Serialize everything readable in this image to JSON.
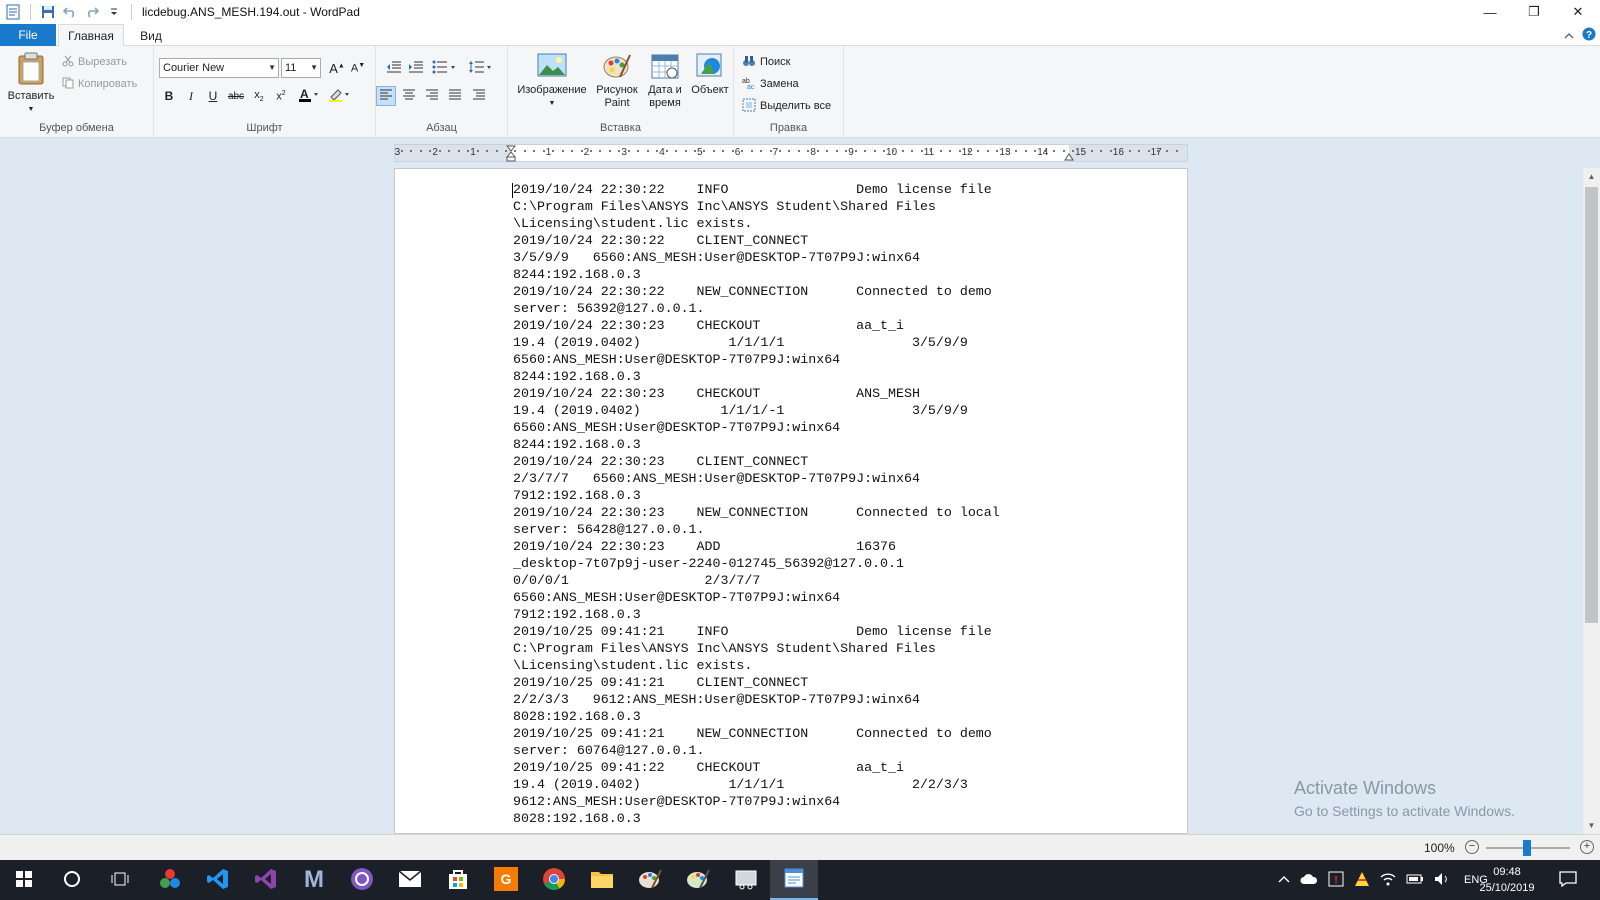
{
  "window": {
    "title": "licdebug.ANS_MESH.194.out - WordPad",
    "minimize_glyph": "—",
    "restore_glyph": "❐",
    "close_glyph": "✕"
  },
  "tabs": {
    "file": "File",
    "home": "Главная",
    "view": "Вид"
  },
  "ribbon": {
    "clipboard": {
      "label": "Буфер обмена",
      "paste": "Вставить",
      "cut": "Вырезать",
      "copy": "Копировать"
    },
    "font": {
      "label": "Шрифт",
      "family": "Courier New",
      "size": "11"
    },
    "paragraph": {
      "label": "Абзац"
    },
    "insert": {
      "label": "Вставка",
      "picture": "Изображение",
      "paint_line1": "Рисунок",
      "paint_line2": "Paint",
      "datetime_line1": "Дата и",
      "datetime_line2": "время",
      "object": "Объект"
    },
    "editing": {
      "label": "Правка",
      "find": "Поиск",
      "replace": "Замена",
      "select_all": "Выделить все"
    }
  },
  "ruler": {
    "ticks": [
      "3",
      "2",
      "1",
      "1",
      "2",
      "3",
      "4",
      "5",
      "6",
      "7",
      "8",
      "9",
      "10",
      "11",
      "12",
      "13",
      "14",
      "15",
      "16",
      "17"
    ]
  },
  "document": {
    "lines": [
      "2019/10/24 22:30:22    INFO                Demo license file",
      "C:\\Program Files\\ANSYS Inc\\ANSYS Student\\Shared Files",
      "\\Licensing\\student.lic exists.",
      "2019/10/24 22:30:22    CLIENT_CONNECT",
      "3/5/9/9   6560:ANS_MESH:User@DESKTOP-7T07P9J:winx64",
      "8244:192.168.0.3",
      "2019/10/24 22:30:22    NEW_CONNECTION      Connected to demo",
      "server: 56392@127.0.0.1.",
      "2019/10/24 22:30:23    CHECKOUT            aa_t_i",
      "19.4 (2019.0402)           1/1/1/1                3/5/9/9",
      "6560:ANS_MESH:User@DESKTOP-7T07P9J:winx64",
      "8244:192.168.0.3",
      "2019/10/24 22:30:23    CHECKOUT            ANS_MESH",
      "19.4 (2019.0402)          1/1/1/-1                3/5/9/9",
      "6560:ANS_MESH:User@DESKTOP-7T07P9J:winx64",
      "8244:192.168.0.3",
      "2019/10/24 22:30:23    CLIENT_CONNECT",
      "2/3/7/7   6560:ANS_MESH:User@DESKTOP-7T07P9J:winx64",
      "7912:192.168.0.3",
      "2019/10/24 22:30:23    NEW_CONNECTION      Connected to local",
      "server: 56428@127.0.0.1.",
      "2019/10/24 22:30:23    ADD                 16376",
      "_desktop-7t07p9j-user-2240-012745_56392@127.0.0.1",
      "0/0/0/1                 2/3/7/7",
      "6560:ANS_MESH:User@DESKTOP-7T07P9J:winx64",
      "7912:192.168.0.3",
      "2019/10/25 09:41:21    INFO                Demo license file",
      "C:\\Program Files\\ANSYS Inc\\ANSYS Student\\Shared Files",
      "\\Licensing\\student.lic exists.",
      "2019/10/25 09:41:21    CLIENT_CONNECT",
      "2/2/3/3   9612:ANS_MESH:User@DESKTOP-7T07P9J:winx64",
      "8028:192.168.0.3",
      "2019/10/25 09:41:21    NEW_CONNECTION      Connected to demo",
      "server: 60764@127.0.0.1.",
      "2019/10/25 09:41:22    CHECKOUT            aa_t_i",
      "19.4 (2019.0402)           1/1/1/1                2/2/3/3",
      "9612:ANS_MESH:User@DESKTOP-7T07P9J:winx64",
      "8028:192.168.0.3"
    ]
  },
  "watermark": {
    "line1": "Activate Windows",
    "line2": "Go to Settings to activate Windows."
  },
  "statusbar": {
    "zoom": "100%",
    "zoom_minus": "−",
    "zoom_plus": "+",
    "zoom_level": 1.0
  },
  "taskbar": {
    "language": "ENG",
    "time": "09:48",
    "date": "25/10/2019"
  },
  "colors": {
    "accent": "#1979ca",
    "workspace": "#dee8f3",
    "taskbar": "#1b1f27"
  }
}
